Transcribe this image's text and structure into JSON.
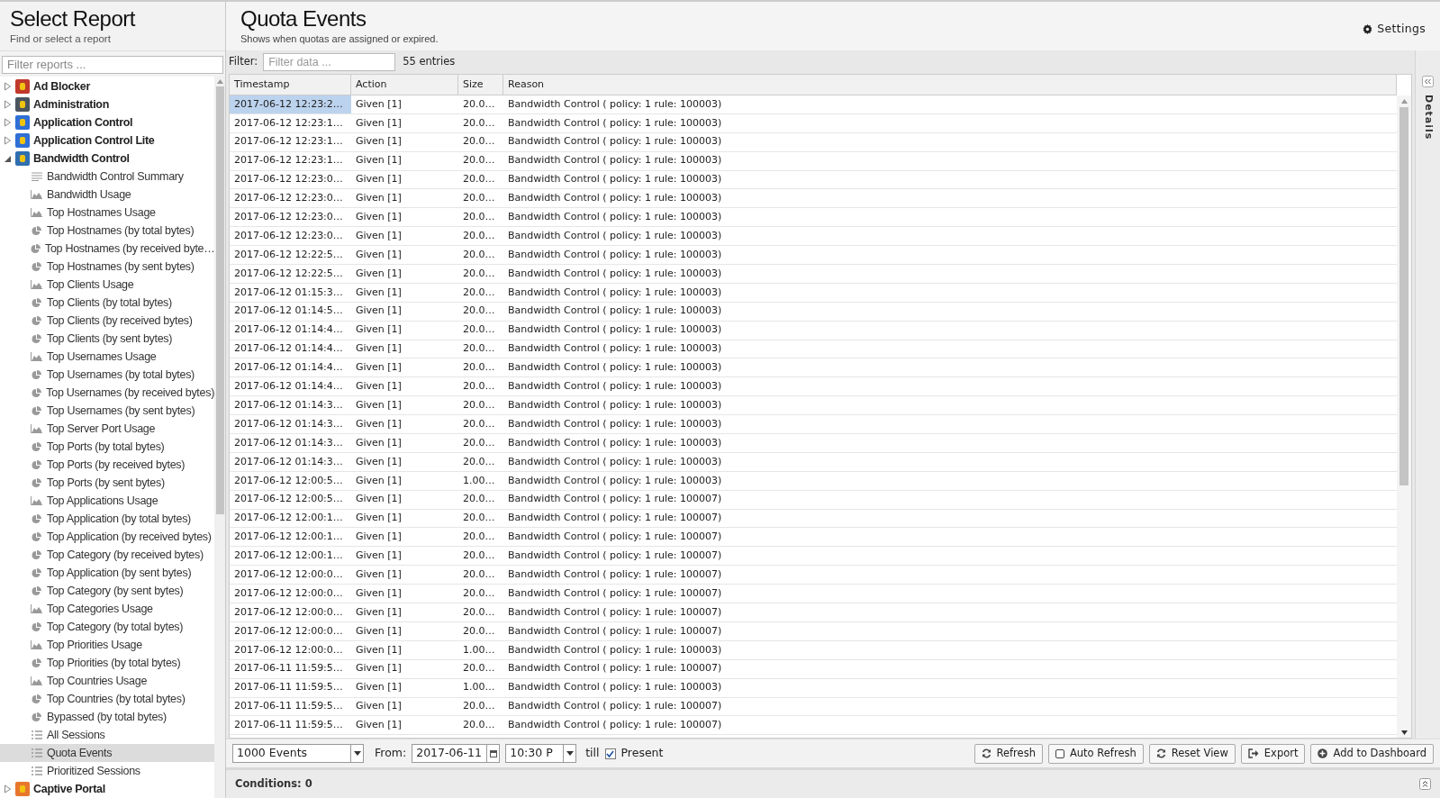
{
  "sidebar": {
    "title": "Select Report",
    "subtitle": "Find or select a report",
    "filter": {
      "placeholder": "Filter reports ..."
    },
    "items": [
      {
        "label": "Ad Blocker",
        "color": "#c0392b",
        "expanded": false
      },
      {
        "label": "Administration",
        "color": "#4a5560",
        "expanded": false
      },
      {
        "label": "Application Control",
        "color": "#2f6fd6",
        "expanded": false
      },
      {
        "label": "Application Control Lite",
        "color": "#2f6fd6",
        "expanded": false
      },
      {
        "label": "Bandwidth Control",
        "color": "#2f6fb0",
        "expanded": true,
        "children": [
          {
            "label": "Bandwidth Control Summary",
            "kind": "summary",
            "selected": false
          },
          {
            "label": "Bandwidth Usage",
            "kind": "area",
            "selected": false
          },
          {
            "label": "Top Hostnames Usage",
            "kind": "area",
            "selected": false
          },
          {
            "label": "Top Hostnames (by total bytes)",
            "kind": "pie",
            "selected": false
          },
          {
            "label": "Top Hostnames (by received byte…",
            "kind": "pie",
            "selected": false
          },
          {
            "label": "Top Hostnames (by sent bytes)",
            "kind": "pie",
            "selected": false
          },
          {
            "label": "Top Clients Usage",
            "kind": "area",
            "selected": false
          },
          {
            "label": "Top Clients (by total bytes)",
            "kind": "pie",
            "selected": false
          },
          {
            "label": "Top Clients (by received bytes)",
            "kind": "pie",
            "selected": false
          },
          {
            "label": "Top Clients (by sent bytes)",
            "kind": "pie",
            "selected": false
          },
          {
            "label": "Top Usernames Usage",
            "kind": "area",
            "selected": false
          },
          {
            "label": "Top Usernames (by total bytes)",
            "kind": "pie",
            "selected": false
          },
          {
            "label": "Top Usernames (by received bytes)",
            "kind": "pie",
            "selected": false
          },
          {
            "label": "Top Usernames (by sent bytes)",
            "kind": "pie",
            "selected": false
          },
          {
            "label": "Top Server Port Usage",
            "kind": "area",
            "selected": false
          },
          {
            "label": "Top Ports (by total bytes)",
            "kind": "pie",
            "selected": false
          },
          {
            "label": "Top Ports (by received bytes)",
            "kind": "pie",
            "selected": false
          },
          {
            "label": "Top Ports (by sent bytes)",
            "kind": "pie",
            "selected": false
          },
          {
            "label": "Top Applications Usage",
            "kind": "area",
            "selected": false
          },
          {
            "label": "Top Application (by total bytes)",
            "kind": "pie",
            "selected": false
          },
          {
            "label": "Top Application (by received bytes)",
            "kind": "pie",
            "selected": false
          },
          {
            "label": "Top Category (by received bytes)",
            "kind": "pie",
            "selected": false
          },
          {
            "label": "Top Application (by sent bytes)",
            "kind": "pie",
            "selected": false
          },
          {
            "label": "Top Category (by sent bytes)",
            "kind": "pie",
            "selected": false
          },
          {
            "label": "Top Categories Usage",
            "kind": "area",
            "selected": false
          },
          {
            "label": "Top Category (by total bytes)",
            "kind": "pie",
            "selected": false
          },
          {
            "label": "Top Priorities Usage",
            "kind": "area",
            "selected": false
          },
          {
            "label": "Top Priorities (by total bytes)",
            "kind": "pie",
            "selected": false
          },
          {
            "label": "Top Countries Usage",
            "kind": "area",
            "selected": false
          },
          {
            "label": "Top Countries (by total bytes)",
            "kind": "pie",
            "selected": false
          },
          {
            "label": "Bypassed (by total bytes)",
            "kind": "pie",
            "selected": false
          },
          {
            "label": "All Sessions",
            "kind": "list",
            "selected": false
          },
          {
            "label": "Quota Events",
            "kind": "list",
            "selected": true
          },
          {
            "label": "Prioritized Sessions",
            "kind": "list",
            "selected": false
          }
        ]
      },
      {
        "label": "Captive Portal",
        "color": "#e8772e",
        "expanded": false
      }
    ]
  },
  "report": {
    "title": "Quota Events",
    "subtitle": "Shows when quotas are assigned or expired.",
    "settings": "Settings"
  },
  "filter": {
    "label": "Filter:",
    "placeholder": "Filter data ...",
    "count": "55 entries"
  },
  "table": {
    "columns": [
      "Timestamp",
      "Action",
      "Size",
      "Reason"
    ],
    "rows": [
      {
        "selected": true,
        "cells": [
          "2017-06-12 12:23:2…",
          "Given [1]",
          "20.0…",
          "Bandwidth Control ( policy: 1 rule: 100003)"
        ]
      },
      {
        "selected": false,
        "cells": [
          "2017-06-12 12:23:1…",
          "Given [1]",
          "20.0…",
          "Bandwidth Control ( policy: 1 rule: 100003)"
        ]
      },
      {
        "selected": false,
        "cells": [
          "2017-06-12 12:23:1…",
          "Given [1]",
          "20.0…",
          "Bandwidth Control ( policy: 1 rule: 100003)"
        ]
      },
      {
        "selected": false,
        "cells": [
          "2017-06-12 12:23:1…",
          "Given [1]",
          "20.0…",
          "Bandwidth Control ( policy: 1 rule: 100003)"
        ]
      },
      {
        "selected": false,
        "cells": [
          "2017-06-12 12:23:0…",
          "Given [1]",
          "20.0…",
          "Bandwidth Control ( policy: 1 rule: 100003)"
        ]
      },
      {
        "selected": false,
        "cells": [
          "2017-06-12 12:23:0…",
          "Given [1]",
          "20.0…",
          "Bandwidth Control ( policy: 1 rule: 100003)"
        ]
      },
      {
        "selected": false,
        "cells": [
          "2017-06-12 12:23:0…",
          "Given [1]",
          "20.0…",
          "Bandwidth Control ( policy: 1 rule: 100003)"
        ]
      },
      {
        "selected": false,
        "cells": [
          "2017-06-12 12:23:0…",
          "Given [1]",
          "20.0…",
          "Bandwidth Control ( policy: 1 rule: 100003)"
        ]
      },
      {
        "selected": false,
        "cells": [
          "2017-06-12 12:22:5…",
          "Given [1]",
          "20.0…",
          "Bandwidth Control ( policy: 1 rule: 100003)"
        ]
      },
      {
        "selected": false,
        "cells": [
          "2017-06-12 12:22:5…",
          "Given [1]",
          "20.0…",
          "Bandwidth Control ( policy: 1 rule: 100003)"
        ]
      },
      {
        "selected": false,
        "cells": [
          "2017-06-12 01:15:3…",
          "Given [1]",
          "20.0…",
          "Bandwidth Control ( policy: 1 rule: 100003)"
        ]
      },
      {
        "selected": false,
        "cells": [
          "2017-06-12 01:14:5…",
          "Given [1]",
          "20.0…",
          "Bandwidth Control ( policy: 1 rule: 100003)"
        ]
      },
      {
        "selected": false,
        "cells": [
          "2017-06-12 01:14:4…",
          "Given [1]",
          "20.0…",
          "Bandwidth Control ( policy: 1 rule: 100003)"
        ]
      },
      {
        "selected": false,
        "cells": [
          "2017-06-12 01:14:4…",
          "Given [1]",
          "20.0…",
          "Bandwidth Control ( policy: 1 rule: 100003)"
        ]
      },
      {
        "selected": false,
        "cells": [
          "2017-06-12 01:14:4…",
          "Given [1]",
          "20.0…",
          "Bandwidth Control ( policy: 1 rule: 100003)"
        ]
      },
      {
        "selected": false,
        "cells": [
          "2017-06-12 01:14:4…",
          "Given [1]",
          "20.0…",
          "Bandwidth Control ( policy: 1 rule: 100003)"
        ]
      },
      {
        "selected": false,
        "cells": [
          "2017-06-12 01:14:3…",
          "Given [1]",
          "20.0…",
          "Bandwidth Control ( policy: 1 rule: 100003)"
        ]
      },
      {
        "selected": false,
        "cells": [
          "2017-06-12 01:14:3…",
          "Given [1]",
          "20.0…",
          "Bandwidth Control ( policy: 1 rule: 100003)"
        ]
      },
      {
        "selected": false,
        "cells": [
          "2017-06-12 01:14:3…",
          "Given [1]",
          "20.0…",
          "Bandwidth Control ( policy: 1 rule: 100003)"
        ]
      },
      {
        "selected": false,
        "cells": [
          "2017-06-12 01:14:3…",
          "Given [1]",
          "20.0…",
          "Bandwidth Control ( policy: 1 rule: 100003)"
        ]
      },
      {
        "selected": false,
        "cells": [
          "2017-06-12 12:00:5…",
          "Given [1]",
          "1.00…",
          "Bandwidth Control ( policy: 1 rule: 100003)"
        ]
      },
      {
        "selected": false,
        "cells": [
          "2017-06-12 12:00:5…",
          "Given [1]",
          "20.0…",
          "Bandwidth Control ( policy: 1 rule: 100007)"
        ]
      },
      {
        "selected": false,
        "cells": [
          "2017-06-12 12:00:1…",
          "Given [1]",
          "20.0…",
          "Bandwidth Control ( policy: 1 rule: 100007)"
        ]
      },
      {
        "selected": false,
        "cells": [
          "2017-06-12 12:00:1…",
          "Given [1]",
          "20.0…",
          "Bandwidth Control ( policy: 1 rule: 100007)"
        ]
      },
      {
        "selected": false,
        "cells": [
          "2017-06-12 12:00:1…",
          "Given [1]",
          "20.0…",
          "Bandwidth Control ( policy: 1 rule: 100007)"
        ]
      },
      {
        "selected": false,
        "cells": [
          "2017-06-12 12:00:0…",
          "Given [1]",
          "20.0…",
          "Bandwidth Control ( policy: 1 rule: 100007)"
        ]
      },
      {
        "selected": false,
        "cells": [
          "2017-06-12 12:00:0…",
          "Given [1]",
          "20.0…",
          "Bandwidth Control ( policy: 1 rule: 100007)"
        ]
      },
      {
        "selected": false,
        "cells": [
          "2017-06-12 12:00:0…",
          "Given [1]",
          "20.0…",
          "Bandwidth Control ( policy: 1 rule: 100007)"
        ]
      },
      {
        "selected": false,
        "cells": [
          "2017-06-12 12:00:0…",
          "Given [1]",
          "20.0…",
          "Bandwidth Control ( policy: 1 rule: 100007)"
        ]
      },
      {
        "selected": false,
        "cells": [
          "2017-06-12 12:00:0…",
          "Given [1]",
          "1.00…",
          "Bandwidth Control ( policy: 1 rule: 100003)"
        ]
      },
      {
        "selected": false,
        "cells": [
          "2017-06-11 11:59:5…",
          "Given [1]",
          "20.0…",
          "Bandwidth Control ( policy: 1 rule: 100007)"
        ]
      },
      {
        "selected": false,
        "cells": [
          "2017-06-11 11:59:5…",
          "Given [1]",
          "1.00…",
          "Bandwidth Control ( policy: 1 rule: 100003)"
        ]
      },
      {
        "selected": false,
        "cells": [
          "2017-06-11 11:59:5…",
          "Given [1]",
          "20.0…",
          "Bandwidth Control ( policy: 1 rule: 100007)"
        ]
      },
      {
        "selected": false,
        "cells": [
          "2017-06-11 11:59:5…",
          "Given [1]",
          "20.0…",
          "Bandwidth Control ( policy: 1 rule: 100007)"
        ]
      }
    ]
  },
  "details": {
    "label": "Details"
  },
  "toolbar": {
    "limit": "1000 Events",
    "from_label": "From:",
    "from_date": "2017-06-11",
    "from_time": "10:30 P",
    "till_label": "till",
    "present": {
      "label": "Present",
      "checked": true
    },
    "buttons": [
      {
        "label": "Refresh",
        "kind": "refresh"
      },
      {
        "label": "Auto Refresh",
        "kind": "checkbox"
      },
      {
        "label": "Reset View",
        "kind": "refresh"
      },
      {
        "label": "Export",
        "kind": "export"
      },
      {
        "label": "Add to Dashboard",
        "kind": "add"
      }
    ]
  },
  "conditions": {
    "label": "Conditions: 0"
  }
}
